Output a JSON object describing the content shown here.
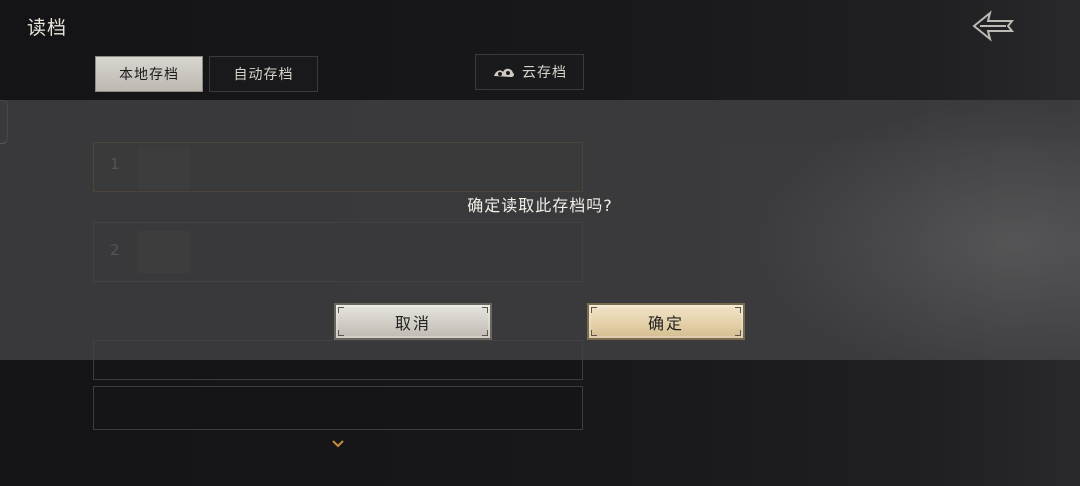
{
  "header": {
    "title": "读档"
  },
  "tabs": {
    "local": "本地存档",
    "auto": "自动存档",
    "cloud": "云存档"
  },
  "save_slots": [
    {
      "number": "1"
    },
    {
      "number": "2"
    }
  ],
  "dialog": {
    "message": "确定读取此存档吗?",
    "cancel_label": "取消",
    "confirm_label": "确定"
  },
  "colors": {
    "accent_orange": "#c98c3e",
    "text_light": "#f2efe8"
  },
  "icons": {
    "back": "back-arrow-icon",
    "cloud": "cloud-icon",
    "scroll": "chevron-down-icon"
  }
}
